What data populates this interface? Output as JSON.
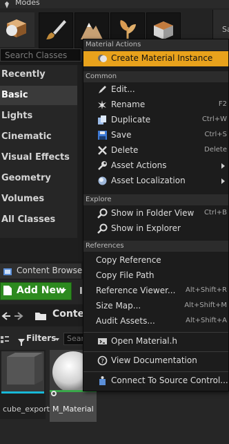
{
  "modes": {
    "title": "Modes",
    "tabs": [
      "Place",
      "Paint",
      "Landscape",
      "Foliage",
      "Geometry Editing"
    ],
    "search_placeholder": "Search Classes",
    "categories": [
      "Recently Placed",
      "Basic",
      "Lights",
      "Cinematic",
      "Visual Effects",
      "Geometry",
      "Volumes",
      "All Classes"
    ],
    "selected_category": "Basic"
  },
  "side_panel": {
    "label": "Sa"
  },
  "content_browser": {
    "title": "Content Browser",
    "add_new_label": "Add New",
    "import_stub": "I",
    "path_label": "Conter",
    "filters_label": "Filters",
    "search_placeholder": "Sear",
    "assets": [
      {
        "name": "cube_export",
        "accent": "#18b8d8"
      },
      {
        "name": "M_Material",
        "accent": "#39a84a"
      }
    ]
  },
  "context_menu": {
    "sections": {
      "material_actions": "Material Actions",
      "common": "Common",
      "explore": "Explore",
      "references": "References"
    },
    "material_actions": [
      {
        "label": "Create Material Instance",
        "icon": "material-instance-icon",
        "highlight": "#e8a21c"
      }
    ],
    "common": [
      {
        "label": "Edit...",
        "icon": "edit-icon",
        "shortcut": ""
      },
      {
        "label": "Rename",
        "icon": "rename-icon",
        "shortcut": "F2"
      },
      {
        "label": "Duplicate",
        "icon": "duplicate-icon",
        "shortcut": "Ctrl+W"
      },
      {
        "label": "Save",
        "icon": "save-icon",
        "shortcut": "Ctrl+S"
      },
      {
        "label": "Delete",
        "icon": "delete-icon",
        "shortcut": "Delete"
      },
      {
        "label": "Asset Actions",
        "icon": "wrench-icon",
        "submenu": true
      },
      {
        "label": "Asset Localization",
        "icon": "globe-icon",
        "submenu": true
      }
    ],
    "explore": [
      {
        "label": "Show in Folder View",
        "icon": "magnifier-icon",
        "shortcut": "Ctrl+B"
      },
      {
        "label": "Show in Explorer",
        "icon": "magnifier-icon",
        "shortcut": ""
      }
    ],
    "references": [
      {
        "label": "Copy Reference",
        "shortcut": ""
      },
      {
        "label": "Copy File Path",
        "shortcut": ""
      },
      {
        "label": "Reference Viewer...",
        "shortcut": "Alt+Shift+R"
      },
      {
        "label": "Size Map...",
        "shortcut": "Alt+Shift+M"
      },
      {
        "label": "Audit Assets...",
        "shortcut": "Alt+Shift+A"
      }
    ],
    "open_source": {
      "label": "Open Material.h",
      "icon": "source-code-icon"
    },
    "view_documentation": {
      "label": "View Documentation",
      "icon": "help-icon"
    },
    "connect_source_control": {
      "label": "Connect To Source Control...",
      "icon": "source-control-icon"
    }
  }
}
